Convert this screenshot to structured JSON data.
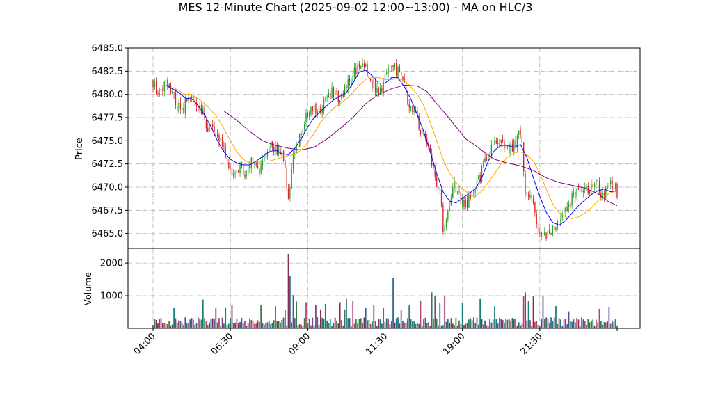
{
  "chart_data": {
    "type": "candlestick",
    "title": "MES 12-Minute Chart (2025-09-02 12:00~13:00) - MA on HLC/3",
    "price_panel": {
      "ylabel": "Price",
      "ylim": [
        6463.4,
        6485.0
      ],
      "yticks": [
        6465.0,
        6467.5,
        6470.0,
        6472.5,
        6475.0,
        6477.5,
        6480.0,
        6482.5,
        6485.0
      ],
      "ytick_labels": [
        "6465.0",
        "6467.5",
        "6470.0",
        "6472.5",
        "6475.0",
        "6477.5",
        "6480.0",
        "6482.5",
        "6485.0"
      ],
      "up_color": "#2ca02c",
      "down_color": "#d62728",
      "close_anchors": [
        [
          0,
          6481.2
        ],
        [
          4,
          6479.8
        ],
        [
          8,
          6481.5
        ],
        [
          10,
          6481.0
        ],
        [
          14,
          6479.0
        ],
        [
          18,
          6478.3
        ],
        [
          22,
          6479.5
        ],
        [
          26,
          6479.0
        ],
        [
          30,
          6478.5
        ],
        [
          34,
          6476.5
        ],
        [
          38,
          6476.0
        ],
        [
          42,
          6475.2
        ],
        [
          46,
          6472.5
        ],
        [
          50,
          6471.3
        ],
        [
          54,
          6472.0
        ],
        [
          58,
          6471.5
        ],
        [
          62,
          6473.0
        ],
        [
          66,
          6472.0
        ],
        [
          70,
          6473.5
        ],
        [
          74,
          6474.5
        ],
        [
          78,
          6473.8
        ],
        [
          81,
          6473.2
        ],
        [
          84,
          6468.8
        ],
        [
          87,
          6473.5
        ],
        [
          91,
          6475.5
        ],
        [
          95,
          6477.8
        ],
        [
          99,
          6478.5
        ],
        [
          103,
          6478.2
        ],
        [
          107,
          6479.5
        ],
        [
          111,
          6480.2
        ],
        [
          115,
          6479.8
        ],
        [
          119,
          6480.5
        ],
        [
          123,
          6481.5
        ],
        [
          127,
          6483.2
        ],
        [
          131,
          6483.5
        ],
        [
          135,
          6481.5
        ],
        [
          139,
          6480.5
        ],
        [
          142,
          6480.0
        ],
        [
          145,
          6482.5
        ],
        [
          149,
          6483.0
        ],
        [
          152,
          6482.5
        ],
        [
          155,
          6481.5
        ],
        [
          158,
          6479.5
        ],
        [
          162,
          6478.5
        ],
        [
          166,
          6476.0
        ],
        [
          170,
          6475.0
        ],
        [
          174,
          6471.5
        ],
        [
          178,
          6469.5
        ],
        [
          180,
          6465.5
        ],
        [
          183,
          6467.5
        ],
        [
          187,
          6470.5
        ],
        [
          191,
          6468.5
        ],
        [
          195,
          6468.3
        ],
        [
          199,
          6469.8
        ],
        [
          203,
          6471.2
        ],
        [
          207,
          6473.2
        ],
        [
          211,
          6474.2
        ],
        [
          215,
          6475.2
        ],
        [
          219,
          6474.0
        ],
        [
          223,
          6474.3
        ],
        [
          227,
          6475.5
        ],
        [
          229,
          6474.8
        ],
        [
          231,
          6469.5
        ],
        [
          235,
          6468.5
        ],
        [
          239,
          6465.5
        ],
        [
          243,
          6465.0
        ],
        [
          247,
          6465.3
        ],
        [
          251,
          6466.0
        ],
        [
          255,
          6467.5
        ],
        [
          259,
          6468.5
        ],
        [
          263,
          6469.3
        ],
        [
          267,
          6469.5
        ],
        [
          271,
          6470.0
        ],
        [
          275,
          6471.0
        ],
        [
          279,
          6469.0
        ],
        [
          283,
          6470.3
        ],
        [
          287,
          6470.2
        ],
        [
          288,
          6469.5
        ]
      ],
      "moving_averages": [
        {
          "color": "#0000ff",
          "points": [
            [
              8,
              6481.0
            ],
            [
              12,
              6480.6
            ],
            [
              16,
              6480.2
            ],
            [
              20,
              6479.6
            ],
            [
              24,
              6479.5
            ],
            [
              28,
              6478.8
            ],
            [
              32,
              6477.8
            ],
            [
              36,
              6476.5
            ],
            [
              40,
              6475.0
            ],
            [
              44,
              6473.8
            ],
            [
              48,
              6473.0
            ],
            [
              52,
              6472.6
            ],
            [
              56,
              6472.4
            ],
            [
              60,
              6472.4
            ],
            [
              64,
              6472.8
            ],
            [
              68,
              6473.3
            ],
            [
              72,
              6473.8
            ],
            [
              76,
              6474.0
            ],
            [
              80,
              6473.6
            ],
            [
              84,
              6473.5
            ],
            [
              88,
              6474.2
            ],
            [
              92,
              6475.2
            ],
            [
              96,
              6476.5
            ],
            [
              100,
              6477.5
            ],
            [
              104,
              6478.2
            ],
            [
              108,
              6478.8
            ],
            [
              112,
              6479.4
            ],
            [
              116,
              6479.8
            ],
            [
              120,
              6480.2
            ],
            [
              124,
              6481.2
            ],
            [
              128,
              6482.4
            ],
            [
              132,
              6482.6
            ],
            [
              136,
              6482.0
            ],
            [
              140,
              6481.2
            ],
            [
              144,
              6481.2
            ],
            [
              148,
              6481.8
            ],
            [
              152,
              6481.8
            ],
            [
              156,
              6480.8
            ],
            [
              160,
              6479.5
            ],
            [
              164,
              6477.8
            ],
            [
              168,
              6476.0
            ],
            [
              172,
              6473.8
            ],
            [
              176,
              6471.5
            ],
            [
              180,
              6469.5
            ],
            [
              184,
              6468.5
            ],
            [
              188,
              6468.3
            ],
            [
              192,
              6468.8
            ],
            [
              196,
              6469.3
            ],
            [
              200,
              6469.8
            ],
            [
              204,
              6471.0
            ],
            [
              208,
              6472.8
            ],
            [
              212,
              6474.0
            ],
            [
              216,
              6474.5
            ],
            [
              220,
              6474.5
            ],
            [
              224,
              6474.3
            ],
            [
              228,
              6474.6
            ],
            [
              232,
              6473.2
            ],
            [
              236,
              6471.0
            ],
            [
              240,
              6469.0
            ],
            [
              244,
              6467.3
            ],
            [
              248,
              6466.2
            ],
            [
              252,
              6465.9
            ],
            [
              256,
              6466.4
            ],
            [
              260,
              6467.2
            ],
            [
              264,
              6468.0
            ],
            [
              268,
              6468.6
            ],
            [
              272,
              6469.2
            ],
            [
              276,
              6469.6
            ],
            [
              280,
              6469.8
            ],
            [
              284,
              6469.5
            ],
            [
              288,
              6469.6
            ]
          ]
        },
        {
          "color": "#ffa500",
          "points": [
            [
              12,
              6480.8
            ],
            [
              16,
              6480.4
            ],
            [
              20,
              6480.0
            ],
            [
              24,
              6480.0
            ],
            [
              28,
              6479.5
            ],
            [
              32,
              6479.0
            ],
            [
              36,
              6478.3
            ],
            [
              40,
              6477.5
            ],
            [
              44,
              6476.3
            ],
            [
              48,
              6475.0
            ],
            [
              52,
              6473.8
            ],
            [
              56,
              6473.0
            ],
            [
              60,
              6472.6
            ],
            [
              64,
              6472.6
            ],
            [
              68,
              6472.8
            ],
            [
              72,
              6472.8
            ],
            [
              76,
              6473.0
            ],
            [
              80,
              6473.2
            ],
            [
              84,
              6473.4
            ],
            [
              88,
              6473.5
            ],
            [
              92,
              6474.0
            ],
            [
              96,
              6474.8
            ],
            [
              100,
              6475.8
            ],
            [
              104,
              6477.0
            ],
            [
              108,
              6477.8
            ],
            [
              112,
              6478.5
            ],
            [
              116,
              6479.0
            ],
            [
              120,
              6479.5
            ],
            [
              124,
              6480.2
            ],
            [
              128,
              6481.0
            ],
            [
              132,
              6481.6
            ],
            [
              136,
              6481.8
            ],
            [
              140,
              6481.8
            ],
            [
              144,
              6481.6
            ],
            [
              148,
              6481.6
            ],
            [
              152,
              6481.7
            ],
            [
              156,
              6481.5
            ],
            [
              160,
              6480.8
            ],
            [
              164,
              6480.0
            ],
            [
              168,
              6478.8
            ],
            [
              172,
              6477.0
            ],
            [
              176,
              6475.0
            ],
            [
              180,
              6473.0
            ],
            [
              184,
              6471.5
            ],
            [
              188,
              6470.5
            ],
            [
              192,
              6469.8
            ],
            [
              196,
              6469.3
            ],
            [
              200,
              6469.0
            ],
            [
              204,
              6469.6
            ],
            [
              208,
              6470.5
            ],
            [
              212,
              6471.5
            ],
            [
              216,
              6472.5
            ],
            [
              220,
              6473.2
            ],
            [
              224,
              6473.7
            ],
            [
              228,
              6473.8
            ],
            [
              232,
              6473.5
            ],
            [
              236,
              6472.8
            ],
            [
              240,
              6471.5
            ],
            [
              244,
              6469.8
            ],
            [
              248,
              6468.2
            ],
            [
              252,
              6467.2
            ],
            [
              256,
              6466.8
            ],
            [
              260,
              6466.6
            ],
            [
              264,
              6466.8
            ],
            [
              268,
              6467.2
            ],
            [
              272,
              6467.8
            ],
            [
              276,
              6468.5
            ],
            [
              280,
              6469.0
            ],
            [
              284,
              6469.4
            ],
            [
              288,
              6469.6
            ]
          ]
        },
        {
          "color": "#800080",
          "points": [
            [
              44,
              6478.2
            ],
            [
              52,
              6477.2
            ],
            [
              60,
              6476.0
            ],
            [
              68,
              6475.0
            ],
            [
              76,
              6474.5
            ],
            [
              84,
              6474.2
            ],
            [
              92,
              6474.0
            ],
            [
              100,
              6474.3
            ],
            [
              108,
              6475.2
            ],
            [
              116,
              6476.3
            ],
            [
              124,
              6477.5
            ],
            [
              132,
              6479.0
            ],
            [
              140,
              6480.0
            ],
            [
              148,
              6480.6
            ],
            [
              156,
              6481.0
            ],
            [
              164,
              6480.9
            ],
            [
              170,
              6480.3
            ],
            [
              176,
              6479.0
            ],
            [
              182,
              6477.8
            ],
            [
              188,
              6476.5
            ],
            [
              194,
              6475.2
            ],
            [
              200,
              6474.5
            ],
            [
              206,
              6473.7
            ],
            [
              212,
              6473.0
            ],
            [
              220,
              6472.6
            ],
            [
              228,
              6472.3
            ],
            [
              236,
              6471.8
            ],
            [
              244,
              6471.0
            ],
            [
              252,
              6470.5
            ],
            [
              260,
              6470.2
            ],
            [
              268,
              6469.9
            ],
            [
              276,
              6469.3
            ],
            [
              282,
              6468.5
            ],
            [
              288,
              6468.0
            ]
          ]
        }
      ]
    },
    "volume_panel": {
      "ylabel": "Volume",
      "ylim": [
        0,
        2450
      ],
      "yticks": [
        1000,
        2000
      ],
      "ytick_labels": [
        "1000",
        "2000"
      ],
      "spikes": [
        [
          13,
          620
        ],
        [
          31,
          880
        ],
        [
          39,
          620
        ],
        [
          45,
          620
        ],
        [
          49,
          720
        ],
        [
          67,
          720
        ],
        [
          76,
          680
        ],
        [
          82,
          560
        ],
        [
          84,
          2280
        ],
        [
          85,
          1600
        ],
        [
          87,
          1020
        ],
        [
          89,
          820
        ],
        [
          95,
          800
        ],
        [
          101,
          720
        ],
        [
          104,
          580
        ],
        [
          107,
          750
        ],
        [
          116,
          800
        ],
        [
          119,
          580
        ],
        [
          120,
          900
        ],
        [
          124,
          850
        ],
        [
          132,
          620
        ],
        [
          137,
          700
        ],
        [
          143,
          620
        ],
        [
          149,
          1550
        ],
        [
          154,
          560
        ],
        [
          159,
          700
        ],
        [
          166,
          850
        ],
        [
          173,
          1100
        ],
        [
          175,
          980
        ],
        [
          178,
          780
        ],
        [
          181,
          980
        ],
        [
          192,
          780
        ],
        [
          203,
          900
        ],
        [
          212,
          680
        ],
        [
          230,
          980
        ],
        [
          231,
          1100
        ],
        [
          233,
          850
        ],
        [
          236,
          1000
        ],
        [
          242,
          980
        ],
        [
          250,
          680
        ],
        [
          258,
          520
        ],
        [
          277,
          600
        ],
        [
          283,
          640
        ]
      ]
    },
    "x_axis": {
      "tick_labels": [
        "04:00",
        "06:30",
        "09:00",
        "11:30",
        "19:00",
        "21:30"
      ],
      "tick_index": [
        0,
        48,
        96,
        144,
        192,
        240
      ],
      "n_bars": 289
    }
  }
}
